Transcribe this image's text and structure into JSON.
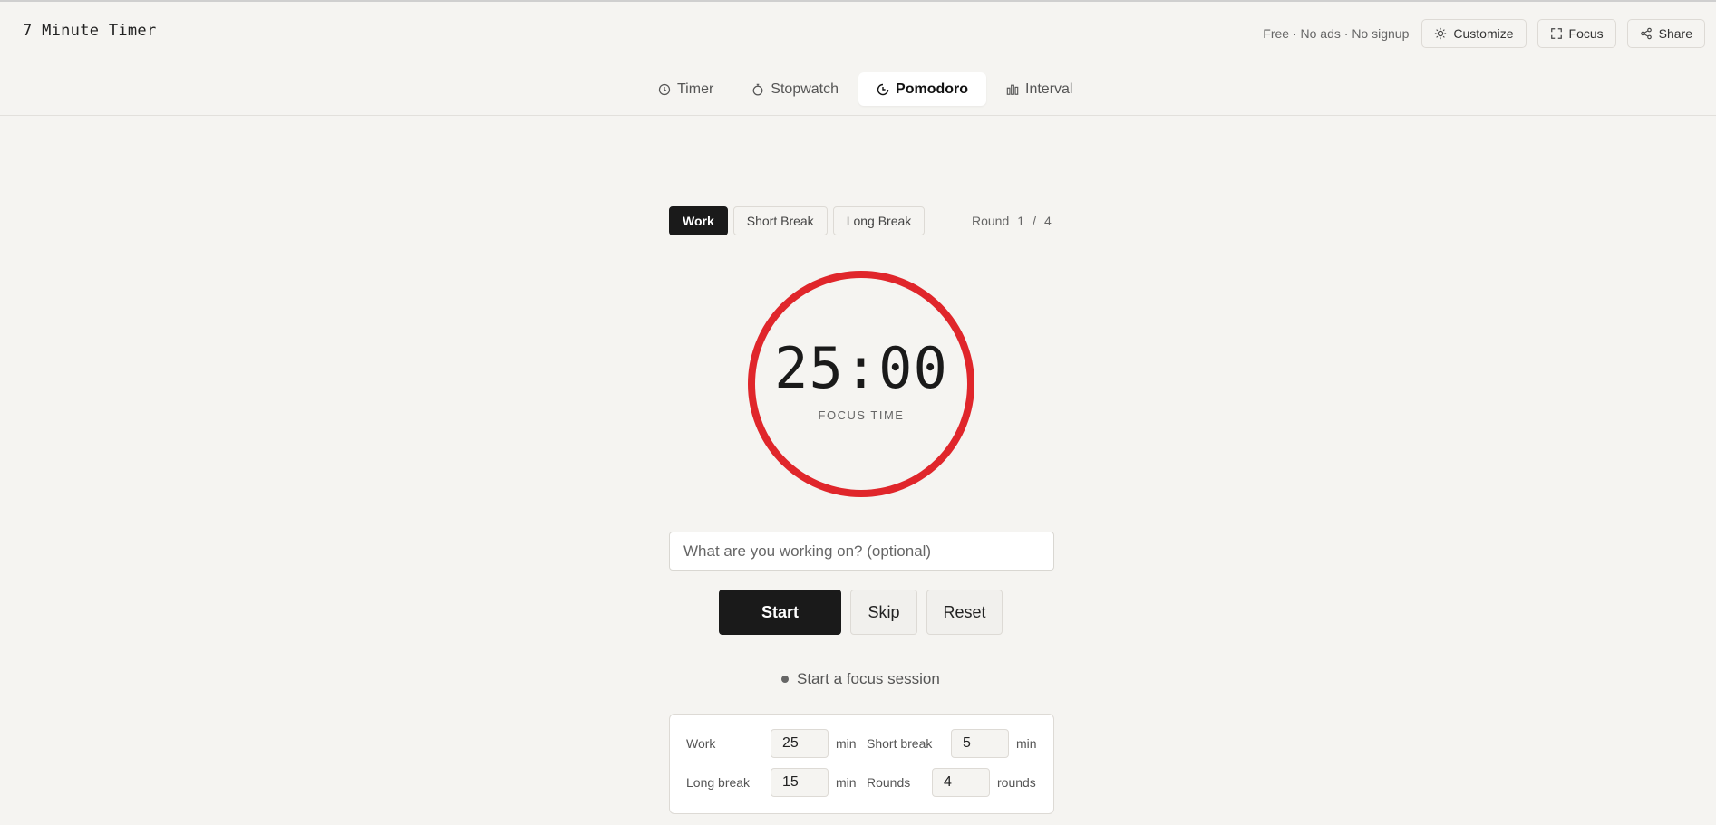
{
  "app": {
    "title": "7 Minute Timer",
    "tagline": "Free · No ads · No signup"
  },
  "top_actions": {
    "customize": "Customize",
    "focus": "Focus",
    "share": "Share"
  },
  "tabs": [
    {
      "label": "Timer",
      "icon": "clock-icon"
    },
    {
      "label": "Stopwatch",
      "icon": "stopwatch-icon"
    },
    {
      "label": "Pomodoro",
      "icon": "pomodoro-icon",
      "active": true
    },
    {
      "label": "Interval",
      "icon": "bar-chart-icon"
    }
  ],
  "modes": {
    "work": "Work",
    "short_break": "Short Break",
    "long_break": "Long Break",
    "selected": "Work"
  },
  "round": {
    "label": "Round",
    "current": "1",
    "separator": "/",
    "total": "4"
  },
  "timer": {
    "display": "25:00",
    "label": "FOCUS TIME",
    "ring_color": "#e0262b",
    "progress": 1.0
  },
  "task": {
    "placeholder": "What are you working on? (optional)",
    "value": ""
  },
  "actions": {
    "start": "Start",
    "skip": "Skip",
    "reset": "Reset"
  },
  "status": "Start a focus session",
  "settings": {
    "work_label": "Work",
    "work_value": "25",
    "work_unit": "min",
    "short_label": "Short break",
    "short_value": "5",
    "short_unit": "min",
    "long_label": "Long break",
    "long_value": "15",
    "long_unit": "min",
    "rounds_label": "Rounds",
    "rounds_value": "4",
    "rounds_unit": "rounds"
  },
  "colors": {
    "accent": "#e0262b",
    "dark": "#1a1a1a",
    "background": "#f5f4f1"
  }
}
